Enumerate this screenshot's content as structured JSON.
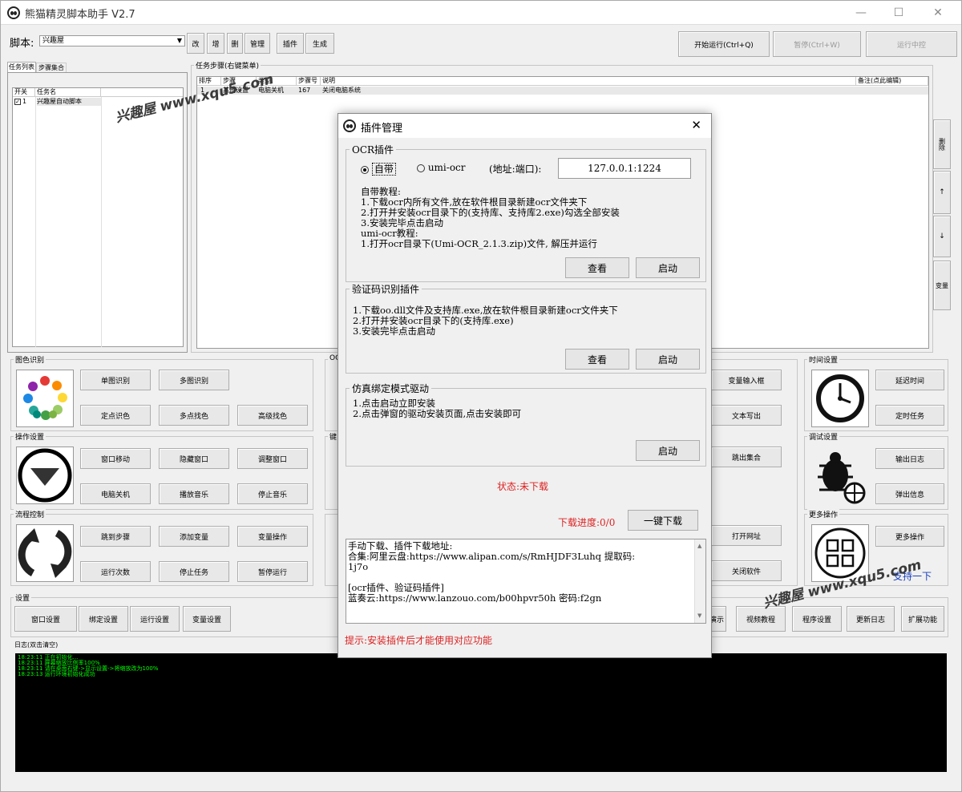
{
  "window": {
    "title": "熊猫精灵脚本助手  V2.7",
    "min": "—",
    "max": "☐",
    "close": "✕"
  },
  "toolbar": {
    "script_label": "脚本:",
    "script_value": "兴趣屋",
    "btn_edit": "改",
    "btn_add": "增",
    "btn_del": "删",
    "btn_manage": "管理",
    "btn_plugin": "插件",
    "btn_generate": "生成",
    "btn_start": "开始运行(Ctrl+Q)",
    "btn_pause": "暂停(Ctrl+W)",
    "btn_stop": "运行中控"
  },
  "left_tabs": {
    "tab1": "任务列表",
    "tab2": "步骤集合"
  },
  "task_list": {
    "col_switch": "开关",
    "col_name": "任务名",
    "rows": [
      {
        "idx": "1",
        "name": "兴趣屋自动脚本"
      }
    ]
  },
  "steps": {
    "label": "任务步骤(右键菜单)",
    "cols": {
      "order": "排序",
      "name": "步骤",
      "type": "类型",
      "stepno": "步骤号",
      "desc": "说明",
      "note": "备注(点此编辑)"
    },
    "rows": [
      {
        "order": "1",
        "name": "其他设置",
        "type": "电脑关机",
        "stepno": "167",
        "desc": "关闭电脑系统"
      }
    ]
  },
  "side_buttons": {
    "del": "删除",
    "up": "↑",
    "down": "↓",
    "var": "变量"
  },
  "groups": {
    "image": {
      "label": "图色识别",
      "b1": "单图识别",
      "b2": "多图识别",
      "b3": "定点识色",
      "b4": "多点找色",
      "b5": "高级找色"
    },
    "ocr": {
      "label": "OCR"
    },
    "operate": {
      "label": "操作设置",
      "b1": "窗口移动",
      "b2": "隐藏窗口",
      "b3": "调整窗口",
      "b4": "电脑关机",
      "b5": "播放音乐",
      "b6": "停止音乐"
    },
    "keyboard": {
      "label": "键鼠"
    },
    "flow": {
      "label": "流程控制",
      "b1": "跳到步骤",
      "b2": "添加变量",
      "b3": "变量操作",
      "b4": "运行次数",
      "b5": "停止任务",
      "b6": "暂停运行"
    },
    "mid_right": {
      "b1": "变量输入框",
      "b2": "文本写出",
      "b3": "跳出集合",
      "b4": "打开网址",
      "b5": "关闭软件"
    },
    "time": {
      "label": "时间设置",
      "b1": "延迟时间",
      "b2": "定时任务"
    },
    "debug": {
      "label": "调试设置",
      "b1": "输出日志",
      "b2": "弹出信息"
    },
    "more": {
      "label": "更多操作",
      "b1": "更多操作",
      "support": "支持一下"
    },
    "settings": {
      "label": "设置",
      "b1": "窗口设置",
      "b2": "绑定设置",
      "b3": "运行设置",
      "b4": "变量设置",
      "b5": "演示",
      "b6": "视频教程",
      "b7": "程序设置",
      "b8": "更新日志",
      "b9": "扩展功能"
    }
  },
  "log": {
    "label": "日志(双击清空)",
    "lines": [
      "18:23:11  正在初始化...",
      "18:23:11  屏幕缩放比例率100%",
      "18:23:11  请在桌面右键->显示设置->将缩放改为100%",
      "18:23:13  运行环境初始化成功"
    ]
  },
  "dialog": {
    "title": "插件管理",
    "ocr": {
      "label": "OCR插件",
      "opt1": "自带",
      "opt2": "umi-ocr",
      "addr_label": "(地址:端口):",
      "addr_value": "127.0.0.1:1224",
      "lines": [
        "自带教程:",
        "1.下载ocr内所有文件,放在软件根目录新建ocr文件夹下",
        "2.打开并安装ocr目录下的(支持库、支持库2.exe)勾选全部安装",
        "3.安装完毕点击启动",
        "umi-ocr教程:",
        "1.打开ocr目录下(Umi-OCR_2.1.3.zip)文件, 解压并运行"
      ],
      "view": "查看",
      "start": "启动"
    },
    "captcha": {
      "label": "验证码识别插件",
      "lines": [
        "1.下载oo.dll文件及支持库.exe,放在软件根目录新建ocr文件夹下",
        "2.打开并安装ocr目录下的(支持库.exe)",
        "3.安装完毕点击启动"
      ],
      "view": "查看",
      "start": "启动"
    },
    "driver": {
      "label": "仿真绑定模式驱动",
      "lines": [
        "1.点击启动立即安装",
        "2.点击弹窗的驱动安装页面,点击安装即可"
      ],
      "start": "启动"
    },
    "status": "状态:未下载",
    "progress": "下载进度:0/0",
    "download_all": "一键下载",
    "text_lines": [
      "手动下载、插件下载地址:",
      "合集:阿里云盘:https://www.alipan.com/s/RmHJDF3Luhq  提取码:",
      "1j7o",
      "",
      "[ocr插件、验证码插件]",
      "蓝奏云:https://www.lanzouo.com/b00hpvr50h    密码:f2gn"
    ],
    "hint": "提示:安装插件后才能使用对应功能"
  },
  "watermarks": [
    "兴趣屋 www.xqu5.com",
    "兴趣屋 www.xqu5.com"
  ],
  "colors": {
    "log_text": "#00ff00",
    "red": "#dd2222",
    "link": "#1a3fbf"
  }
}
